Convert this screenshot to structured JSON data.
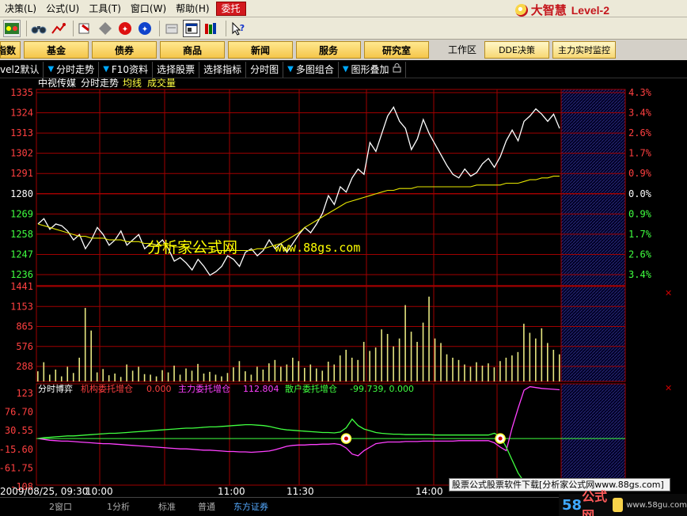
{
  "menu": {
    "items": [
      "决策(L)",
      "公式(U)",
      "工具(T)",
      "窗口(W)",
      "帮助(H)"
    ],
    "active_item": "委托",
    "brand_cn": "大智慧",
    "brand_level": "Level-2"
  },
  "toolbar": {
    "icons": [
      "chart-icon",
      "binoculars-icon",
      "signal-icon",
      "stock-pick-icon",
      "diamond-icon",
      "red-circle-icon",
      "blue-circle-icon",
      "notepad-icon",
      "window-icon",
      "books-icon",
      "help-pointer-icon"
    ]
  },
  "funcbar": {
    "buttons": [
      "指数",
      "基金",
      "债券",
      "商品",
      "新闻",
      "服务",
      "研究室"
    ],
    "workspace_label": "工作区",
    "dde_label": "DDE决策",
    "monitor_label": "主力实时监控"
  },
  "subbar": {
    "items": [
      "vel2默认",
      "分时走势",
      "F10资料",
      "选择股票",
      "选择指标",
      "分时图",
      "多图组合",
      "图形叠加"
    ]
  },
  "chart_header": {
    "stock_name": "中视传媒",
    "view_name": "分时走势",
    "avg_label": "均线",
    "vol_label": "成交量"
  },
  "watermark": {
    "cn": "分析家公式网",
    "url": "www.88gs.com"
  },
  "colors": {
    "background": "#000000",
    "grid": "#a00000",
    "price_line": "#ffffff",
    "avg_line": "#e6e600",
    "volume": "#e6e680",
    "up": "#ff4040",
    "down": "#40ff40",
    "inst": "#ff4040",
    "main": "#ff40ff",
    "retail": "#40ff40"
  },
  "chart_data": {
    "type": "line",
    "title": "中视传媒 分时走势",
    "price_axis_left": [
      "1335",
      "1324",
      "1313",
      "1302",
      "1291",
      "1280",
      "1269",
      "1258",
      "1247",
      "1236"
    ],
    "price_axis_right": [
      "4.3%",
      "3.4%",
      "2.6%",
      "1.7%",
      "0.9%",
      "0.0%",
      "0.9%",
      "1.7%",
      "2.6%",
      "3.4%"
    ],
    "price_ylim": [
      1230,
      1340
    ],
    "pre_close": 1280,
    "volume_axis": [
      "1441",
      "1153",
      "865",
      "576",
      "288"
    ],
    "volume_ylim": [
      0,
      1441
    ],
    "time_labels": [
      "2009/08/25, 09:30",
      "10:00",
      "11:00",
      "11:30",
      "14:00"
    ],
    "series": [
      {
        "name": "price",
        "values": [
          1264,
          1267,
          1261,
          1264,
          1263,
          1260,
          1255,
          1258,
          1250,
          1255,
          1262,
          1258,
          1252,
          1255,
          1260,
          1252,
          1255,
          1258,
          1250,
          1253,
          1252,
          1255,
          1250,
          1243,
          1245,
          1242,
          1238,
          1244,
          1240,
          1235,
          1237,
          1240,
          1246,
          1244,
          1240,
          1248,
          1250,
          1246,
          1249,
          1255,
          1250,
          1253,
          1248,
          1253,
          1258,
          1262,
          1259,
          1264,
          1270,
          1280,
          1275,
          1285,
          1282,
          1290,
          1295,
          1292,
          1310,
          1305,
          1315,
          1325,
          1330,
          1322,
          1318,
          1306,
          1312,
          1323,
          1315,
          1309,
          1303,
          1297,
          1292,
          1290,
          1295,
          1291,
          1293,
          1298,
          1301,
          1296,
          1302,
          1311,
          1317,
          1311,
          1322,
          1325,
          1329,
          1326,
          1322,
          1326,
          1318
        ]
      },
      {
        "name": "avg",
        "values": [
          1264,
          1263,
          1262,
          1261,
          1260,
          1259,
          1258,
          1257,
          1257,
          1256,
          1256,
          1256,
          1255,
          1255,
          1255,
          1254,
          1254,
          1254,
          1253,
          1253,
          1252,
          1252,
          1252,
          1251,
          1251,
          1251,
          1250,
          1250,
          1250,
          1250,
          1249,
          1249,
          1249,
          1249,
          1249,
          1249,
          1249,
          1250,
          1250,
          1251,
          1252,
          1253,
          1255,
          1257,
          1259,
          1262,
          1264,
          1266,
          1268,
          1270,
          1272,
          1274,
          1276,
          1277,
          1278,
          1279,
          1280,
          1281,
          1282,
          1283,
          1283,
          1284,
          1284,
          1284,
          1285,
          1285,
          1285,
          1285,
          1285,
          1285,
          1285,
          1285,
          1285,
          1285,
          1286,
          1286,
          1286,
          1286,
          1286,
          1287,
          1287,
          1287,
          1288,
          1289,
          1289,
          1290,
          1290,
          1291,
          1291
        ]
      }
    ],
    "volumes": [
      180,
      340,
      120,
      210,
      90,
      260,
      150,
      420,
      1300,
      900,
      160,
      220,
      110,
      140,
      80,
      300,
      190,
      260,
      130,
      120,
      90,
      200,
      160,
      280,
      120,
      230,
      190,
      310,
      140,
      170,
      120,
      90,
      150,
      250,
      360,
      180,
      120,
      260,
      210,
      320,
      380,
      260,
      300,
      420,
      360,
      240,
      300,
      230,
      190,
      350,
      300,
      460,
      560,
      420,
      380,
      700,
      540,
      600,
      920,
      840,
      620,
      760,
      1350,
      880,
      700,
      1040,
      1500,
      760,
      680,
      480,
      420,
      380,
      300,
      260,
      340,
      280,
      320,
      250,
      360,
      420,
      460,
      520,
      1020,
      860,
      760,
      940,
      680,
      560,
      480
    ],
    "indicator": {
      "title": "分时博弈",
      "legend": [
        {
          "name": "机构委托增仓",
          "value": "0.000"
        },
        {
          "name": "主力委托增仓",
          "value": "112.804"
        },
        {
          "name": "散户委托增仓",
          "value": "-99.739, 0.000"
        }
      ],
      "axis": [
        "123",
        "76.70",
        "30.55",
        "-15.60",
        "-61.75",
        "-108"
      ],
      "ylim": [
        -108,
        123
      ],
      "main": [
        0,
        -2,
        -4,
        -5,
        -6,
        -6,
        -7,
        -8,
        -9,
        -10,
        -11,
        -12,
        -12,
        -13,
        -14,
        -15,
        -16,
        -17,
        -18,
        -19,
        -20,
        -21,
        -22,
        -23,
        -24,
        -24,
        -25,
        -26,
        -27,
        -27,
        -28,
        -29,
        -30,
        -30,
        -31,
        -31,
        -32,
        -31,
        -30,
        -29,
        -26,
        -22,
        -18,
        -16,
        -15,
        -15,
        -14,
        -14,
        -13,
        -13,
        -12,
        -14,
        -22,
        -36,
        -40,
        -28,
        -20,
        -12,
        -10,
        -8,
        -8,
        -8,
        -7,
        -7,
        -7,
        -6,
        -6,
        -6,
        -6,
        -6,
        -6,
        -5,
        -5,
        -5,
        -5,
        -5,
        -5,
        -10,
        -20,
        -28,
        25,
        70,
        112,
        120,
        118,
        116,
        115,
        114,
        113
      ],
      "retail": [
        0,
        2,
        3,
        4,
        5,
        6,
        6,
        7,
        8,
        9,
        10,
        11,
        12,
        12,
        13,
        14,
        15,
        16,
        17,
        18,
        19,
        20,
        21,
        22,
        23,
        24,
        24,
        25,
        26,
        27,
        27,
        28,
        29,
        30,
        31,
        32,
        32,
        31,
        30,
        28,
        25,
        22,
        20,
        19,
        18,
        17,
        16,
        15,
        14,
        14,
        13,
        15,
        25,
        45,
        30,
        22,
        18,
        14,
        12,
        11,
        10,
        10,
        9,
        9,
        9,
        9,
        9,
        8,
        8,
        8,
        8,
        8,
        8,
        8,
        8,
        8,
        8,
        12,
        5,
        -20,
        -50,
        -80,
        -100,
        -100,
        -100,
        -100,
        -100,
        -100,
        -100
      ]
    }
  },
  "download_banner": "股票公式股票软件下载[分析家公式网www.88gs.com]",
  "status": {
    "tab1": "2窗口",
    "tab2": "1分析",
    "tab3": "标准",
    "tab4": "普通",
    "tab5": "东方证券"
  },
  "site_logo": {
    "num": "58",
    "cn": "公式网",
    "url": "www.58gu.com"
  }
}
